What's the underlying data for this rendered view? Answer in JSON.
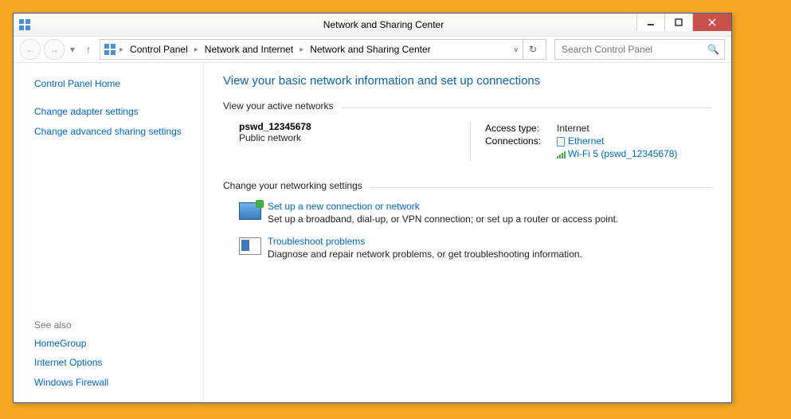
{
  "titlebar": {
    "title": "Network and Sharing Center"
  },
  "breadcrumb": {
    "items": [
      "Control Panel",
      "Network and Internet",
      "Network and Sharing Center"
    ]
  },
  "search": {
    "placeholder": "Search Control Panel"
  },
  "sidebar": {
    "home": "Control Panel Home",
    "links": [
      "Change adapter settings",
      "Change advanced sharing settings"
    ],
    "seealso_label": "See also",
    "seealso": [
      "HomeGroup",
      "Internet Options",
      "Windows Firewall"
    ]
  },
  "main": {
    "heading": "View your basic network information and set up connections",
    "active_label": "View your active networks",
    "network": {
      "name": "pswd_12345678",
      "type": "Public network",
      "access_label": "Access type:",
      "access_value": "Internet",
      "conn_label": "Connections:",
      "ethernet": "Ethernet",
      "wifi": "Wi-Fi 5 (pswd_12345678)"
    },
    "change_label": "Change your networking settings",
    "setup": {
      "title": "Set up a new connection or network",
      "desc": "Set up a broadband, dial-up, or VPN connection; or set up a router or access point."
    },
    "trouble": {
      "title": "Troubleshoot problems",
      "desc": "Diagnose and repair network problems, or get troubleshooting information."
    }
  }
}
